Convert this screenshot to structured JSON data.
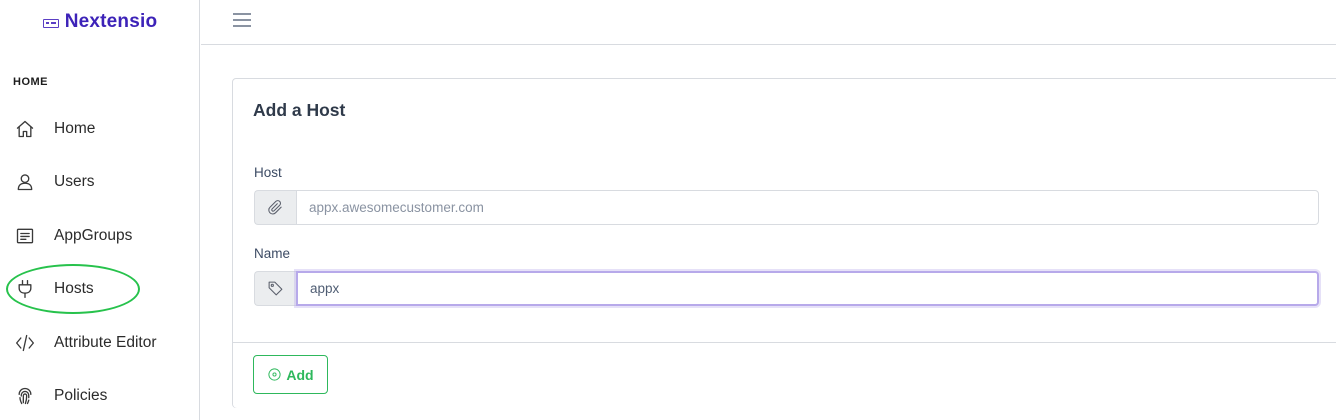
{
  "brand": {
    "name": "Nextensio",
    "icon": "keyboard-icon"
  },
  "sidebar": {
    "section_title": "HOME",
    "items": [
      {
        "label": "Home",
        "icon": "home-icon"
      },
      {
        "label": "Users",
        "icon": "user-icon"
      },
      {
        "label": "AppGroups",
        "icon": "list-icon"
      },
      {
        "label": "Hosts",
        "icon": "plug-icon",
        "highlighted": true
      },
      {
        "label": "Attribute Editor",
        "icon": "code-icon"
      },
      {
        "label": "Policies",
        "icon": "fingerprint-icon"
      }
    ]
  },
  "header": {
    "menu_icon": "hamburger-icon"
  },
  "card": {
    "title": "Add a Host",
    "host": {
      "label": "Host",
      "placeholder": "appx.awesomecustomer.com",
      "value": "",
      "icon": "paperclip-icon"
    },
    "name": {
      "label": "Name",
      "placeholder": "",
      "value": "appx",
      "icon": "tag-icon"
    },
    "add_button": {
      "label": "Add",
      "icon": "circle-dot-icon"
    }
  },
  "colors": {
    "brand": "#3d23b8",
    "success": "#2eb85c",
    "highlight_ellipse": "#27c24c",
    "focus_border": "#b7a9ea"
  }
}
